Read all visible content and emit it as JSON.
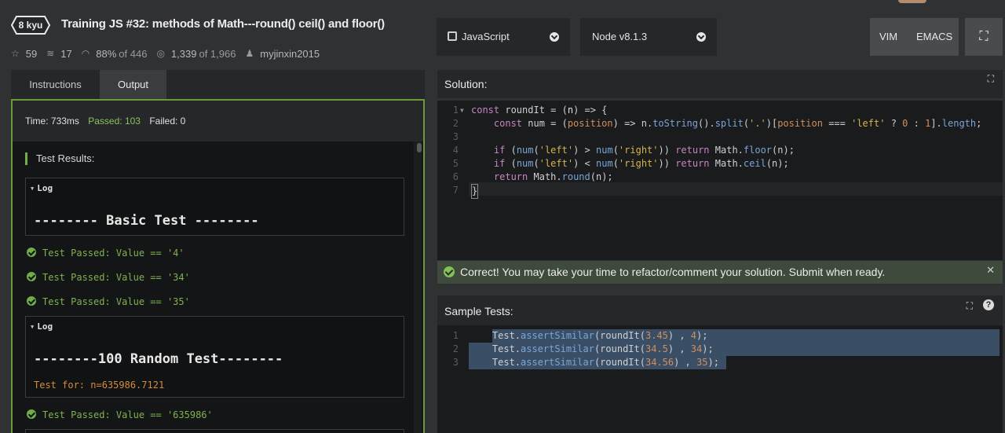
{
  "kata": {
    "rank": "8 kyu",
    "title": "Training JS #32: methods of Math---round() ceil() and floor()",
    "stars": "59",
    "collections": "17",
    "satisfaction_pct": "88%",
    "satisfaction_of": "of 446",
    "completed": "1,339",
    "completed_of": "of 1,966",
    "author": "myjinxin2015"
  },
  "tabs": {
    "instructions": "Instructions",
    "output": "Output"
  },
  "output": {
    "time": "Time: 733ms",
    "passed": "Passed: 103",
    "failed": "Failed: 0",
    "results_heading": "Test Results:",
    "log_label": "Log",
    "log1_heading": "-------- Basic Test --------",
    "passes": [
      "Test Passed: Value == '4'",
      "Test Passed: Value == '34'",
      "Test Passed: Value == '35'",
      "Test Passed: Value == '635986'"
    ],
    "log2_heading": "--------100 Random Test--------",
    "log2_line": "Test for: n=635986.7121"
  },
  "toolbar": {
    "language": "JavaScript",
    "version": "Node v8.1.3",
    "vim": "VIM",
    "emacs": "EMACS"
  },
  "solution": {
    "heading": "Solution:",
    "line_numbers": [
      "1",
      "2",
      "3",
      "4",
      "5",
      "6",
      "7"
    ]
  },
  "correct_message": "Correct! You may take your time to refactor/comment your solution. Submit when ready.",
  "sample_tests": {
    "heading": "Sample Tests:",
    "line_numbers": [
      "1",
      "2",
      "3"
    ]
  },
  "colors": {
    "accent_green": "#6fae48",
    "panel_border": "#6b9a3c",
    "selection": "#3a4f66"
  },
  "icons": [
    "star-icon",
    "collection-icon",
    "eye-icon",
    "target-icon",
    "user-icon",
    "chevron-down-icon",
    "fullscreen-icon",
    "close-icon",
    "help-icon",
    "check-icon"
  ]
}
